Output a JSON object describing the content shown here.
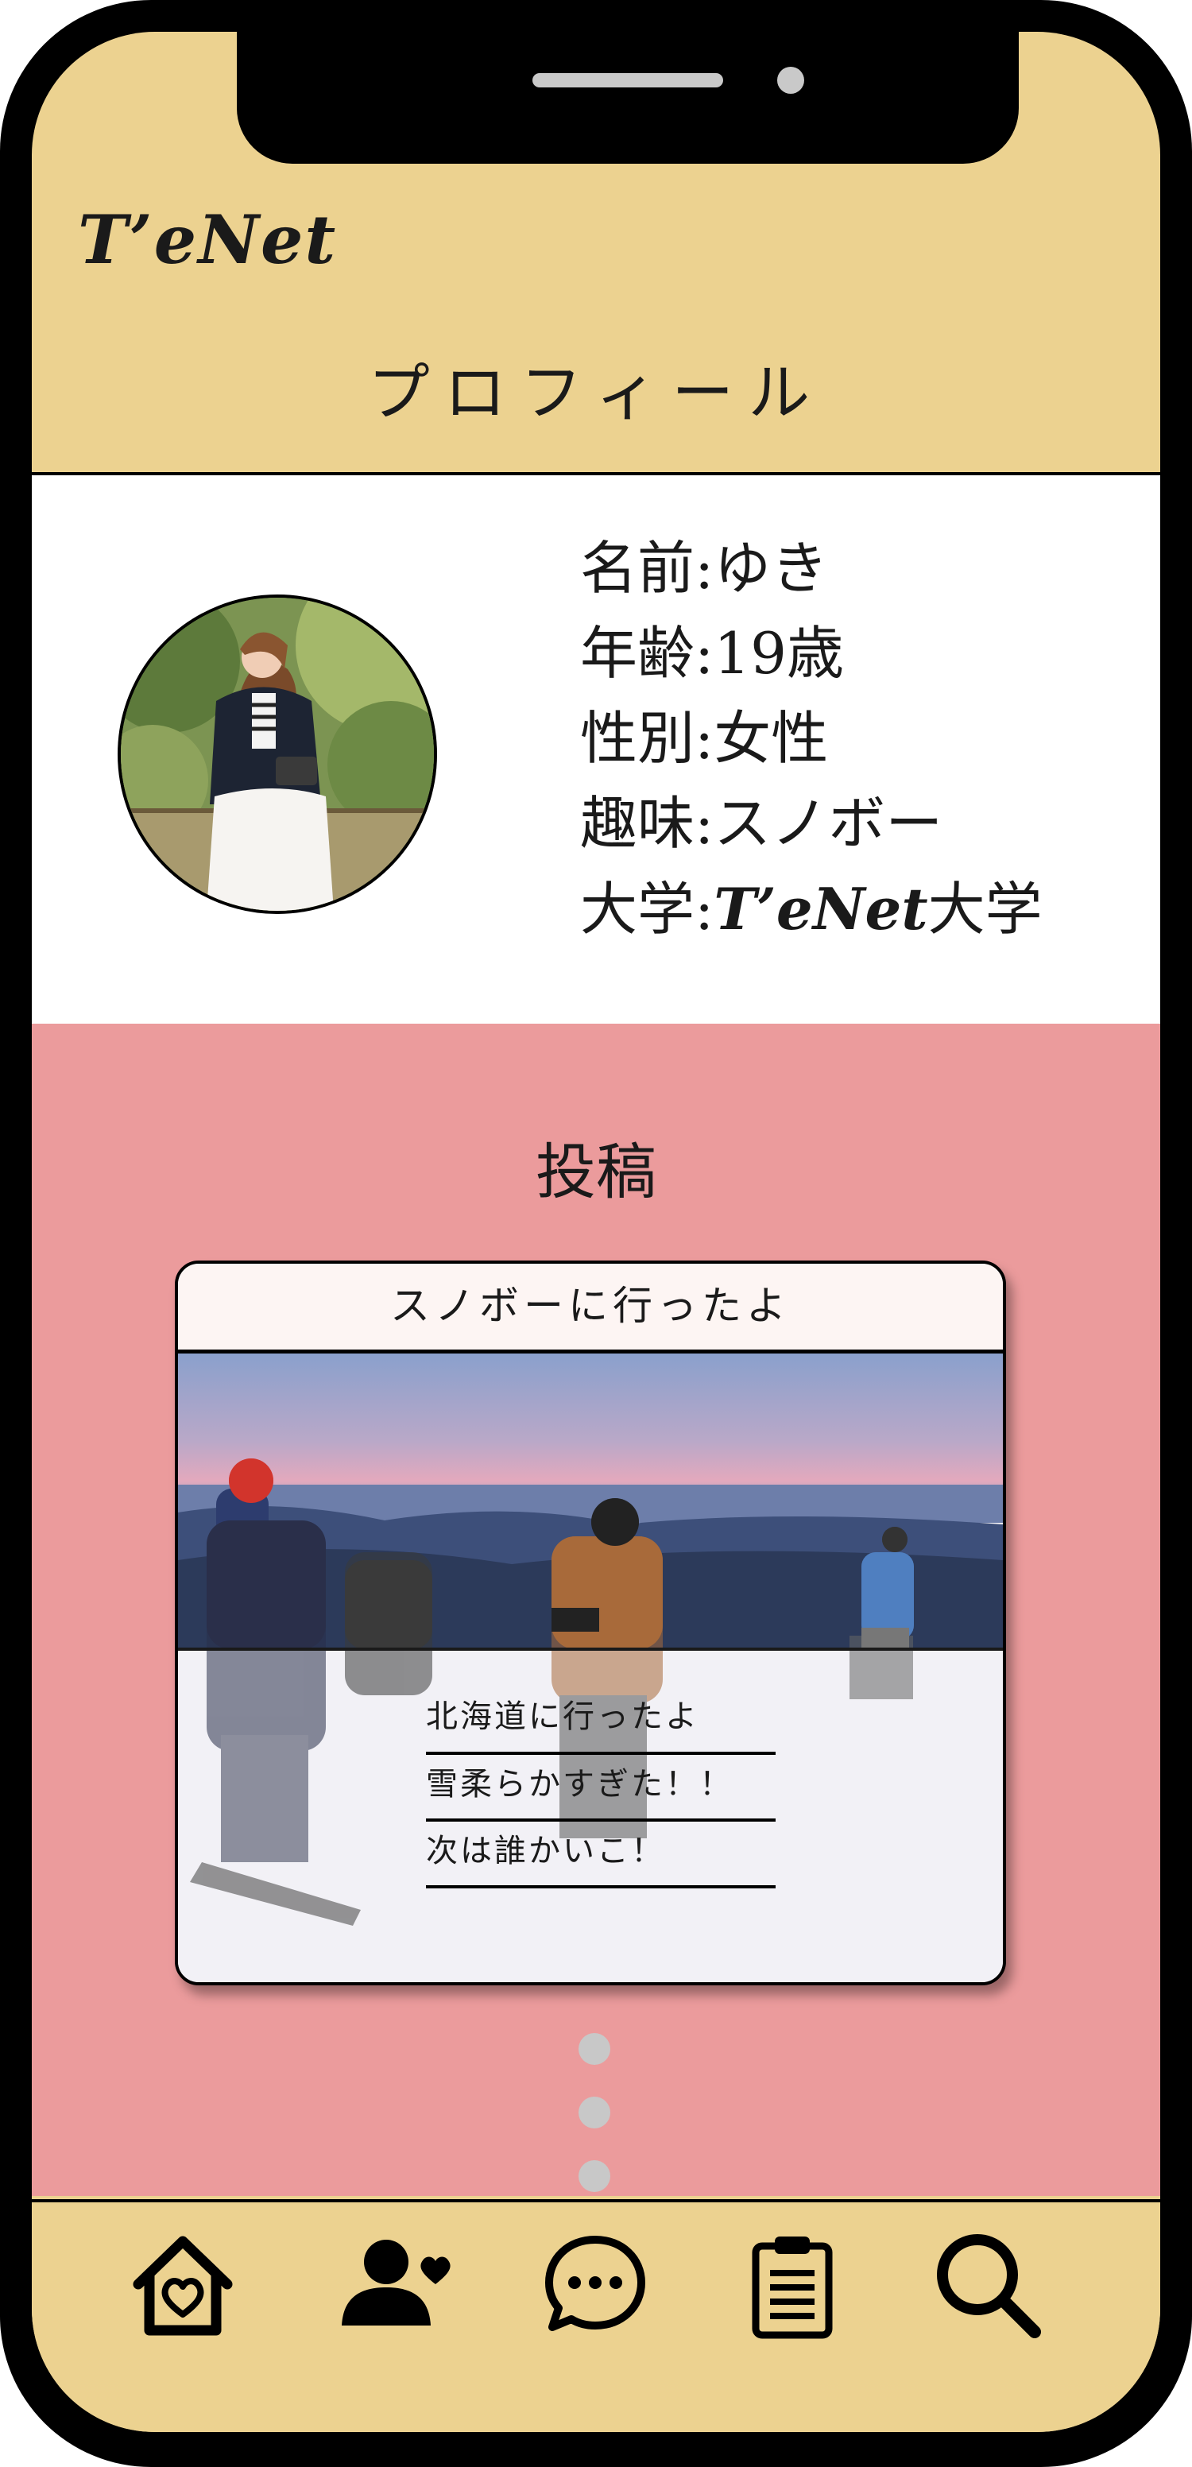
{
  "app": {
    "logo": "T’eNet"
  },
  "header": {
    "title": "プロフィール"
  },
  "profile": {
    "fields": [
      {
        "label": "名前",
        "sep": ":",
        "value": "ゆき"
      },
      {
        "label": "年齢",
        "sep": ":",
        "value": "19歳"
      },
      {
        "label": "性別",
        "sep": ":",
        "value": "女性"
      },
      {
        "label": "趣味",
        "sep": ":",
        "value": "スノボー"
      }
    ],
    "university": {
      "label": "大学",
      "sep": ":",
      "brand": "T’eNet",
      "suffix": "大学"
    }
  },
  "posts": {
    "title": "投稿",
    "card": {
      "title": "スノボーに行ったよ",
      "lines": [
        "北海道に行ったよ",
        "雪柔らかすぎた！！",
        "次は誰かいこ！"
      ]
    }
  },
  "nav": {
    "items": [
      {
        "icon": "home-heart-icon"
      },
      {
        "icon": "friends-icon"
      },
      {
        "icon": "chat-icon"
      },
      {
        "icon": "clipboard-icon"
      },
      {
        "icon": "search-icon"
      }
    ]
  },
  "colors": {
    "header_bg": "#ECD290",
    "posts_bg": "#EB9B9C",
    "card_head_bg": "#FDF5F3"
  }
}
